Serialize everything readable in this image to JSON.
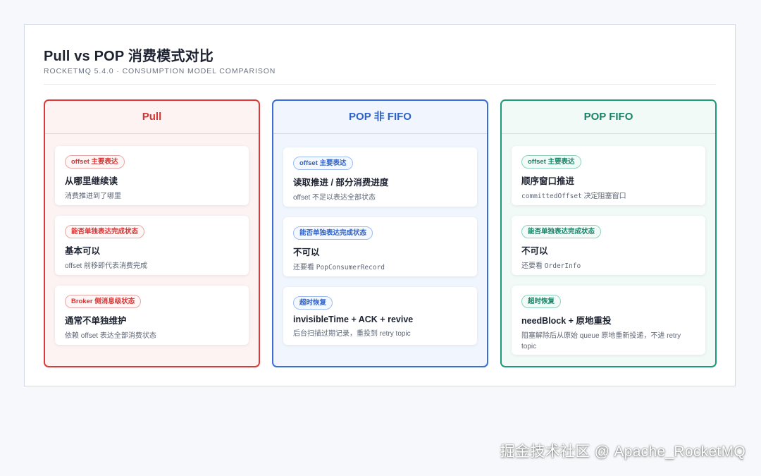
{
  "title": "Pull vs POP 消费模式对比",
  "subtitle": "ROCKETMQ 5.4.0 · CONSUMPTION MODEL COMPARISON",
  "columns": [
    {
      "header": "Pull",
      "accent": "#dc3a3a",
      "cards": [
        {
          "tag": "offset 主要表达",
          "title": "从哪里继续读",
          "desc_pre": "消费推进到了哪里",
          "desc_code": "",
          "desc_post": ""
        },
        {
          "tag": "能否单独表达完成状态",
          "title": "基本可以",
          "desc_pre": "offset 前移即代表消费完成",
          "desc_code": "",
          "desc_post": ""
        },
        {
          "tag": "Broker 侧消息级状态",
          "title": "通常不单独维护",
          "desc_pre": "依赖 offset 表达全部消费状态",
          "desc_code": "",
          "desc_post": ""
        }
      ]
    },
    {
      "header": "POP 非 FIFO",
      "accent": "#3b6fd6",
      "cards": [
        {
          "tag": "offset 主要表达",
          "title": "读取推进 / 部分消费进度",
          "desc_pre": "offset 不足以表达全部状态",
          "desc_code": "",
          "desc_post": ""
        },
        {
          "tag": "能否单独表达完成状态",
          "title": "不可以",
          "desc_pre": "还要看 ",
          "desc_code": "PopConsumerRecord",
          "desc_post": ""
        },
        {
          "tag": "超时恢复",
          "title": "invisibleTime + ACK + revive",
          "desc_pre": "后台扫描过期记录，重投到 retry topic",
          "desc_code": "",
          "desc_post": ""
        }
      ]
    },
    {
      "header": "POP FIFO",
      "accent": "#1d9a78",
      "cards": [
        {
          "tag": "offset 主要表达",
          "title": "顺序窗口推进",
          "desc_pre": "",
          "desc_code": "committedOffset",
          "desc_post": " 决定阻塞窗口"
        },
        {
          "tag": "能否单独表达完成状态",
          "title": "不可以",
          "desc_pre": "还要看 ",
          "desc_code": "OrderInfo",
          "desc_post": ""
        },
        {
          "tag": "超时恢复",
          "title": "needBlock + 原地重投",
          "desc_pre": "阻塞解除后从原始 queue 原地重新投递，不进 retry topic",
          "desc_code": "",
          "desc_post": ""
        }
      ]
    }
  ],
  "watermark": "掘金技术社区 @ Apache_RocketMQ"
}
